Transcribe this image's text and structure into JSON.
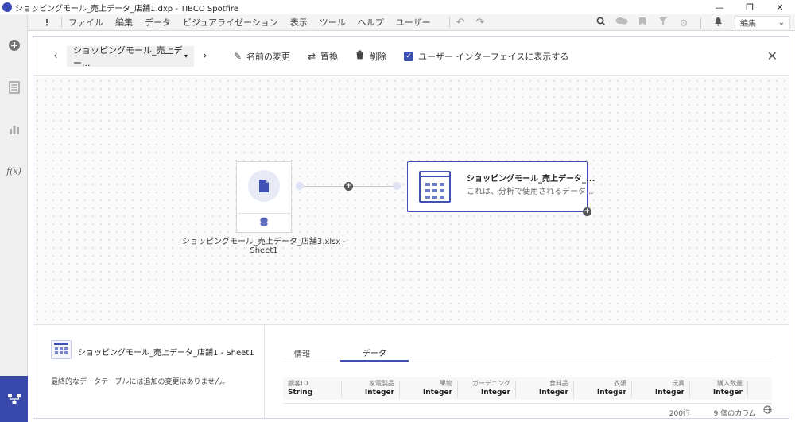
{
  "window": {
    "title": "ショッピングモール_売上データ_店舗1.dxp - TIBCO Spotfire",
    "minimize": "—",
    "restore": "❐",
    "close": "✕"
  },
  "menubar": {
    "items": [
      "ファイル",
      "編集",
      "データ",
      "ビジュアライゼーション",
      "表示",
      "ツール",
      "ヘルプ",
      "ユーザー"
    ],
    "edit_mode": "編集"
  },
  "toolbar": {
    "datasource": "ショッピングモール_売上デー...",
    "rename": "名前の変更",
    "replace": "置換",
    "delete": "削除",
    "show_in_ui": "ユーザー インターフェイスに表示する",
    "show_in_ui_checked": true
  },
  "canvas": {
    "source_label": "ショッピングモール_売上データ_店舗3.xlsx - Sheet1",
    "table_title": "ショッピングモール_売上データ_...",
    "table_subtitle": "これは、分析で使用されるデータ..."
  },
  "details": {
    "title": "ショッピングモール_売上データ_店舗1 - Sheet1",
    "message": "最終的なデータテーブルには追加の変更はありません。",
    "tabs": [
      "情報",
      "データ"
    ],
    "active_tab": "データ",
    "columns": [
      {
        "name": "顧客ID",
        "type": "String"
      },
      {
        "name": "家電製品",
        "type": "Integer"
      },
      {
        "name": "果物",
        "type": "Integer"
      },
      {
        "name": "ガーデニング",
        "type": "Integer"
      },
      {
        "name": "食料品",
        "type": "Integer"
      },
      {
        "name": "衣類",
        "type": "Integer"
      },
      {
        "name": "玩具",
        "type": "Integer"
      },
      {
        "name": "購入数量",
        "type": "Integer"
      }
    ],
    "row_count": "200行",
    "column_count": "9 個のカラム"
  },
  "colors": {
    "accent": "#3f51b5",
    "rail_active": "#3949ab"
  }
}
